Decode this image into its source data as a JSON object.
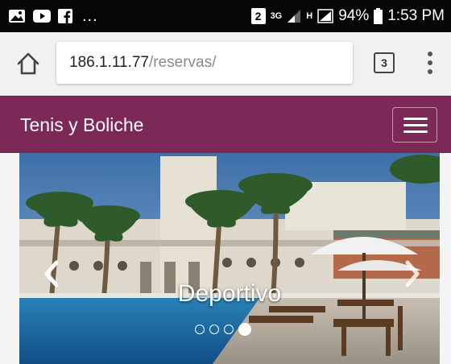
{
  "status_bar": {
    "more": "...",
    "sim_badge": "2",
    "network_3g": "3G",
    "network_h": "H",
    "battery": "94%",
    "time": "1:53 PM",
    "icons": [
      "gallery-icon",
      "youtube-icon",
      "facebook-icon",
      "signal-icon",
      "battery-icon"
    ]
  },
  "browser": {
    "url_host": "186.1.11.77",
    "url_path": "/reservas/",
    "tab_count": "3",
    "icons": [
      "home-icon",
      "menu-dots-icon"
    ]
  },
  "navbar": {
    "brand": "Tenis y Boliche",
    "color": "#7d2957",
    "icons": [
      "hamburger-icon"
    ]
  },
  "carousel": {
    "caption": "Deportivo",
    "slide_count": 4,
    "active_index": 3,
    "icons": [
      "chevron-left-icon",
      "chevron-right-icon"
    ]
  }
}
